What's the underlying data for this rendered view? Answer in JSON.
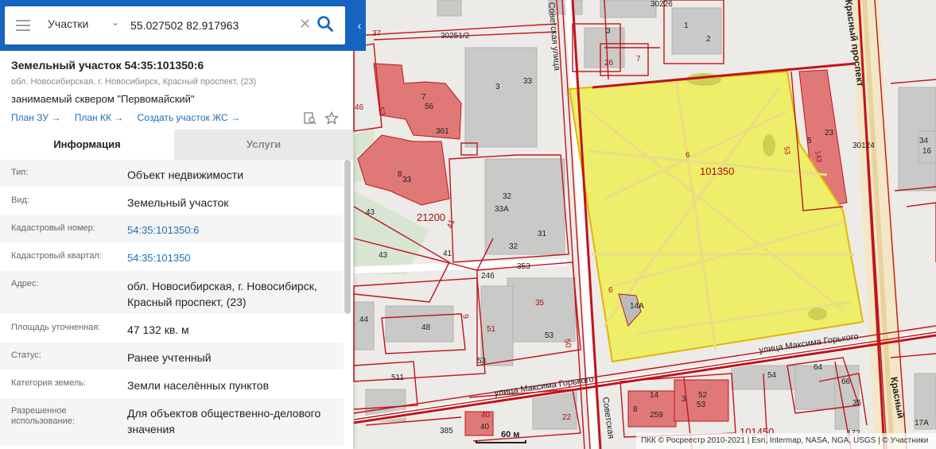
{
  "search": {
    "mode": "Участки",
    "query": "55.027502 82.917963"
  },
  "parcel": {
    "title": "Земельный участок 54:35:101350:6",
    "address_short": "обл. Новосибирская, г. Новосибирск, Красный проспект, (23)",
    "description": "занимаемый сквером \"Первомайский\"",
    "links": [
      "План ЗУ →",
      "План КК →",
      "Создать участок ЖС →"
    ]
  },
  "tabs": [
    "Информация",
    "Услуги"
  ],
  "info_rows": [
    {
      "key": "Тип:",
      "value": "Объект недвижимости",
      "link": false
    },
    {
      "key": "Вид:",
      "value": "Земельный участок",
      "link": false
    },
    {
      "key": "Кадастровый номер:",
      "value": "54:35:101350:6",
      "link": true
    },
    {
      "key": "Кадастровый квартал:",
      "value": "54:35:101350",
      "link": true
    },
    {
      "key": "Адрес:",
      "value": "обл. Новосибирская, г. Новосибирск, Красный проспект, (23)",
      "link": false
    },
    {
      "key": "Площадь уточненная:",
      "value": "47 132 кв. м",
      "link": false
    },
    {
      "key": "Статус:",
      "value": "Ранее учтенный",
      "link": false
    },
    {
      "key": "Категория земель:",
      "value": "Земли населённых пунктов",
      "link": false
    },
    {
      "key": "Разрешенное использование:",
      "value": "Для объектов общественно-делового значения",
      "link": false
    }
  ],
  "map": {
    "scale_label": "60 м",
    "attribution": "ПКК © Росреестр 2010-2021 | Esri, Intermap, NASA, NGA, USGS | © Участники",
    "highlight_color": "#eeee6a",
    "boundary_color": "#c0141c",
    "building_pink": "#e07878",
    "labels": {
      "parcel_number": "101350",
      "parcel_id": "6",
      "street_gorky_1": "улица Максима Горького",
      "street_gorky_2": "улица Максима Горького",
      "street_sovetskaya_top": "Советская улица",
      "street_sovetskaya_bottom": "Советская",
      "street_krasny_top": "Красный проспект",
      "street_krasny_bottom": "Красный",
      "quarter_21200": "21200",
      "quarter_101450": "101450",
      "quarter_30124": "30124",
      "quarter_30226": "30226",
      "quarter_30251": "30251/2",
      "n14a": "14А",
      "n53a": "53",
      "n23": "23",
      "n5": "5",
      "n143": "143",
      "n34": "34",
      "n16": "16",
      "n37": "37",
      "n3a": "3",
      "n1": "1",
      "n2": "2",
      "n26": "26",
      "n7a": "7",
      "n33a": "33",
      "n3b": "3",
      "n46": "46",
      "n53b": "53",
      "n7b": "7",
      "n56": "56",
      "n361": "361",
      "n8": "8",
      "n33b": "33",
      "n32a": "32",
      "n33A": "33А",
      "n32b": "32",
      "n31": "31",
      "n43a": "43",
      "n43b": "43",
      "n41a": "41",
      "n41b": "41",
      "n353": "353",
      "n246": "246",
      "n35a": "35",
      "n44": "44",
      "n48": "48",
      "n9": "9",
      "n51a": "51",
      "n53c": "53",
      "n50": "50",
      "n53d": "53",
      "n511": "511",
      "n40a": "40",
      "n385": "385",
      "n40b": "40",
      "n22": "22",
      "n14": "14",
      "n8b": "8",
      "n259": "259",
      "n3c": "3",
      "n52": "52",
      "n53e": "53",
      "n54": "54",
      "n64": "64",
      "n66": "66",
      "n35b": "35",
      "n172": "172",
      "n17A": "17А",
      "n6": "6"
    }
  }
}
